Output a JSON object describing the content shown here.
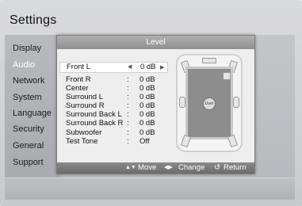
{
  "screen": {
    "title": "Settings"
  },
  "menu": {
    "items": [
      {
        "label": "Display"
      },
      {
        "label": "Audio"
      },
      {
        "label": "Network"
      },
      {
        "label": "System"
      },
      {
        "label": "Language"
      },
      {
        "label": "Security"
      },
      {
        "label": "General"
      },
      {
        "label": "Support"
      }
    ],
    "active": "Audio"
  },
  "popup": {
    "title": "Level",
    "selected": "Front L",
    "rows": [
      {
        "label": "Front L",
        "sep": "◀",
        "value": "0 dB",
        "right": "▶"
      },
      {
        "label": "Front R",
        "sep": ":",
        "value": "0 dB"
      },
      {
        "label": "Center",
        "sep": ":",
        "value": "0 dB"
      },
      {
        "label": "Surround L",
        "sep": ":",
        "value": "0 dB"
      },
      {
        "label": "Surround R",
        "sep": ":",
        "value": "0 dB"
      },
      {
        "label": "Surround Back L",
        "sep": ":",
        "value": "0 dB"
      },
      {
        "label": "Surround Back R",
        "sep": ":",
        "value": "0 dB"
      },
      {
        "label": "Subwoofer",
        "sep": ":",
        "value": "0 dB"
      },
      {
        "label": "Test Tone",
        "sep": ":",
        "value": "Off"
      }
    ],
    "diagram": {
      "user_label": "User"
    },
    "help": {
      "move_icon": "▲▼",
      "move": "Move",
      "change_icon": "◀▶",
      "change": "Change",
      "return_icon": "↺",
      "return": "Return"
    }
  },
  "colors": {
    "header": "#9f9f9f",
    "help_bar": "#7c7c7c",
    "popup_bg": "#eeeeee"
  }
}
